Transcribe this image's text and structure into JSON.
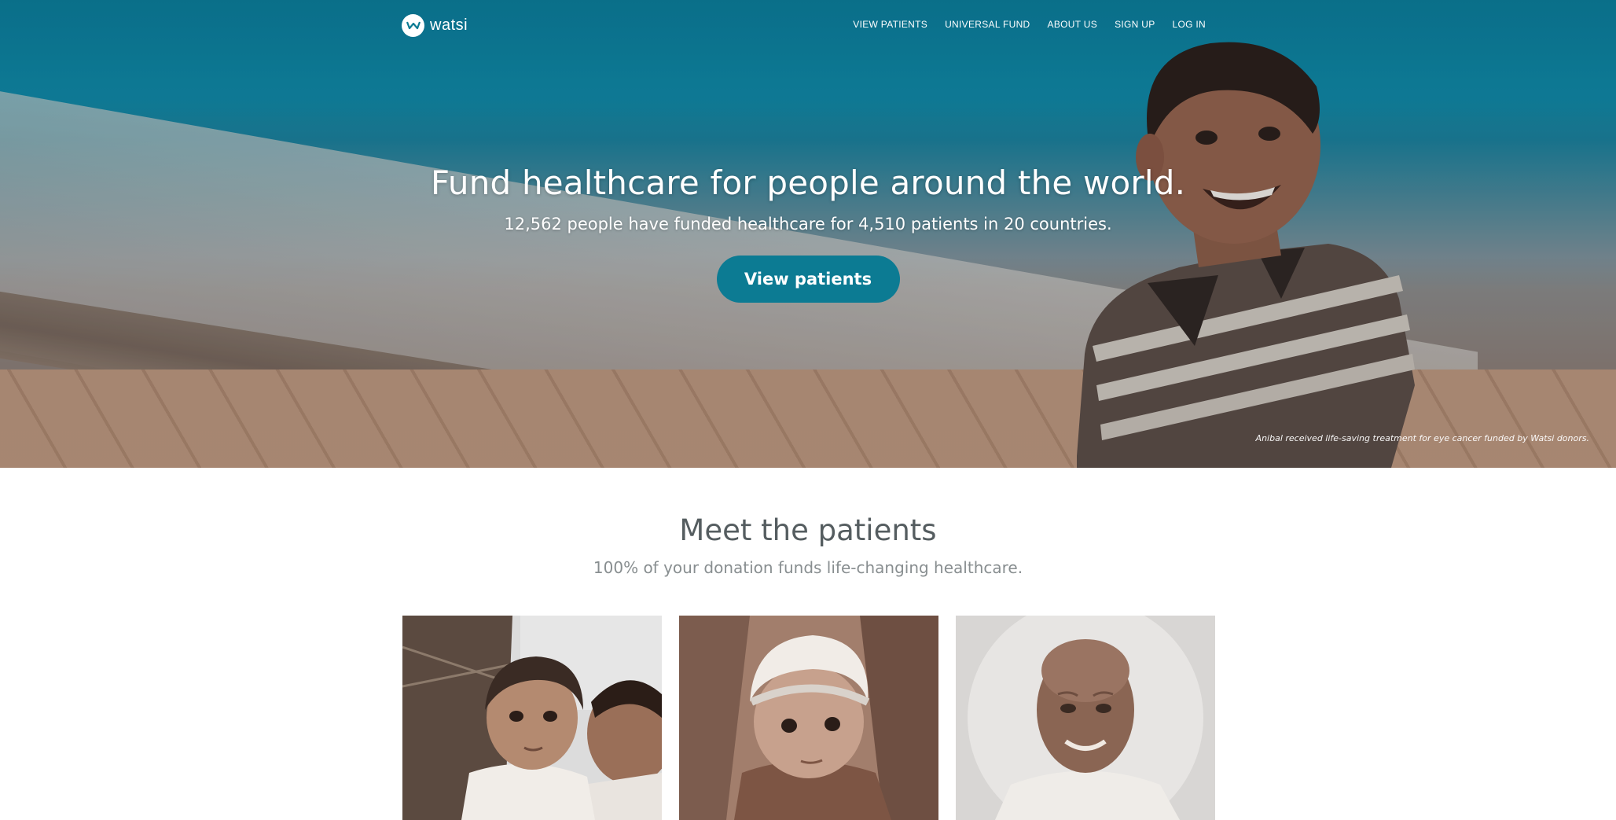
{
  "nav": {
    "logo_text": "watsi",
    "links": [
      "VIEW PATIENTS",
      "UNIVERSAL FUND",
      "ABOUT US",
      "SIGN UP",
      "LOG IN"
    ]
  },
  "hero": {
    "title": "Fund healthcare for people around the world.",
    "subtitle": "12,562 people have funded healthcare for 4,510 patients in 20 countries.",
    "cta_label": "View patients",
    "caption": "Anibal received life-saving treatment for eye cancer funded by Watsi donors."
  },
  "meet": {
    "title": "Meet the patients",
    "subtitle": "100% of your donation funds life-changing healthcare."
  },
  "colors": {
    "brand": "#0c7b93",
    "heading": "#555d60",
    "subtext": "#888e90"
  }
}
